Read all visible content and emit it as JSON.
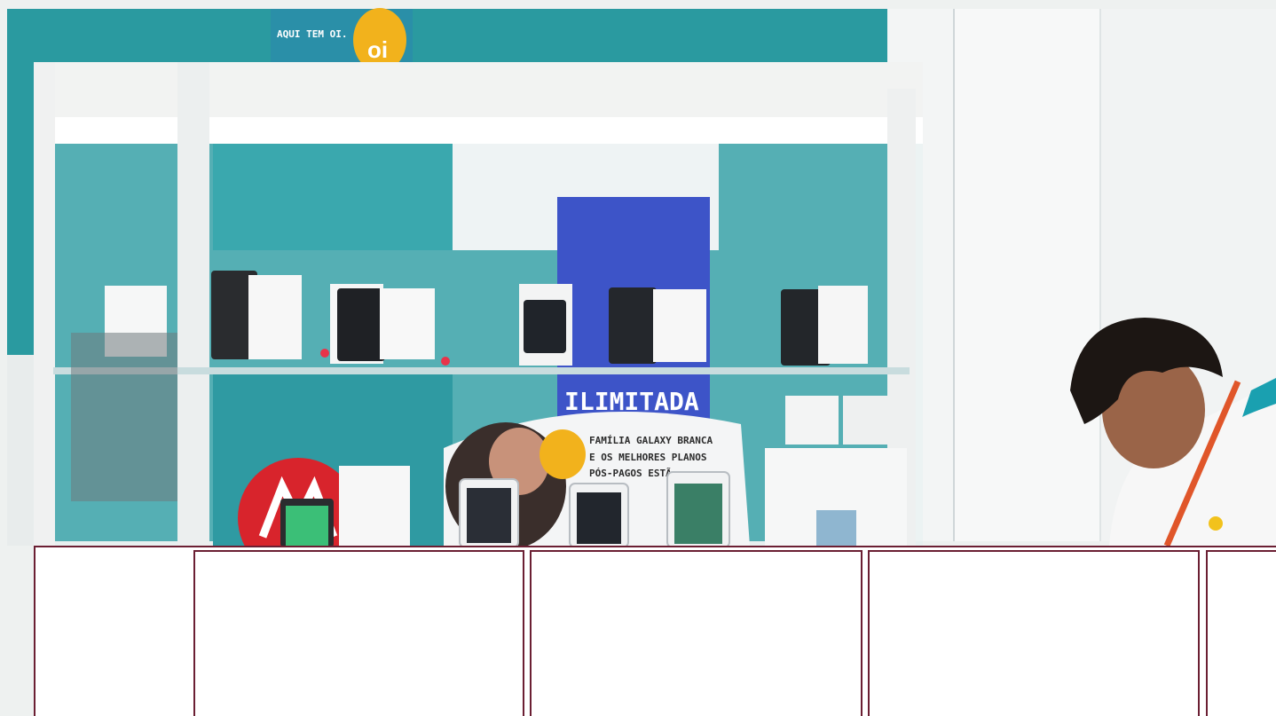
{
  "photo": {
    "sign_top": "AQUI TEM OI.",
    "logo": "oi",
    "poster_line1": "FAMÍLIA GALAXY BRANCA",
    "poster_line2": "E OS MELHORES PLANOS",
    "poster_line3": "PÓS-PAGOS ESTÃ...",
    "banner_text": "ILIMITADA",
    "colors": {
      "teal_wall": "#2a9aa0",
      "oi_yellow": "#f2b21c",
      "motorola_red": "#d8242c",
      "banner_blue": "#3d54c8",
      "card_border": "#6b1f33"
    }
  },
  "cards": [
    {
      "id": "card-1"
    },
    {
      "id": "card-2"
    },
    {
      "id": "card-3"
    },
    {
      "id": "card-4"
    }
  ]
}
